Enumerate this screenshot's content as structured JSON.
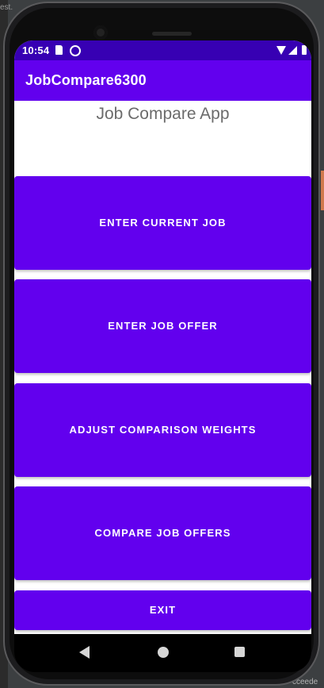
{
  "status_bar": {
    "time": "10:54"
  },
  "app_bar": {
    "title": "JobCompare6300"
  },
  "main": {
    "heading": "Job Compare App",
    "buttons": [
      {
        "label": "ENTER CURRENT JOB"
      },
      {
        "label": "ENTER JOB OFFER"
      },
      {
        "label": "ADJUST COMPARISON WEIGHTS"
      },
      {
        "label": "COMPARE JOB OFFERS"
      },
      {
        "label": "EXIT"
      }
    ]
  },
  "background": {
    "top_text": "est.",
    "bottom_text": "cceede"
  },
  "colors": {
    "primary": "#6200ee",
    "primary_dark": "#3700b3",
    "button_text": "#ffffff",
    "heading_text": "#6b6b6b"
  },
  "icons": {
    "status": [
      "sd-card-icon",
      "sync-icon",
      "wifi-icon",
      "signal-icon",
      "battery-icon"
    ],
    "nav": [
      "back-icon",
      "home-icon",
      "recents-icon"
    ]
  }
}
